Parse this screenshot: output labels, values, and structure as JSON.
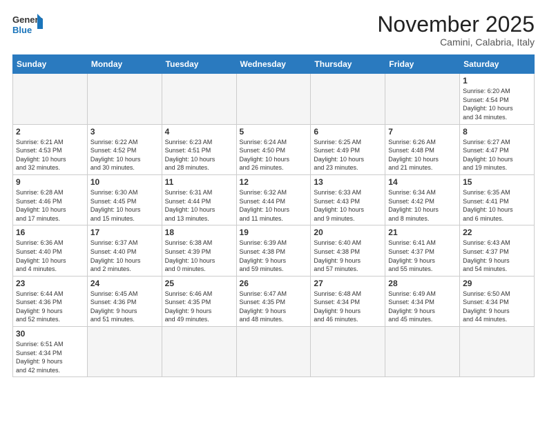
{
  "header": {
    "logo_general": "General",
    "logo_blue": "Blue",
    "month_title": "November 2025",
    "location": "Camini, Calabria, Italy"
  },
  "weekdays": [
    "Sunday",
    "Monday",
    "Tuesday",
    "Wednesday",
    "Thursday",
    "Friday",
    "Saturday"
  ],
  "weeks": [
    [
      {
        "day": "",
        "info": ""
      },
      {
        "day": "",
        "info": ""
      },
      {
        "day": "",
        "info": ""
      },
      {
        "day": "",
        "info": ""
      },
      {
        "day": "",
        "info": ""
      },
      {
        "day": "",
        "info": ""
      },
      {
        "day": "1",
        "info": "Sunrise: 6:20 AM\nSunset: 4:54 PM\nDaylight: 10 hours\nand 34 minutes."
      }
    ],
    [
      {
        "day": "2",
        "info": "Sunrise: 6:21 AM\nSunset: 4:53 PM\nDaylight: 10 hours\nand 32 minutes."
      },
      {
        "day": "3",
        "info": "Sunrise: 6:22 AM\nSunset: 4:52 PM\nDaylight: 10 hours\nand 30 minutes."
      },
      {
        "day": "4",
        "info": "Sunrise: 6:23 AM\nSunset: 4:51 PM\nDaylight: 10 hours\nand 28 minutes."
      },
      {
        "day": "5",
        "info": "Sunrise: 6:24 AM\nSunset: 4:50 PM\nDaylight: 10 hours\nand 26 minutes."
      },
      {
        "day": "6",
        "info": "Sunrise: 6:25 AM\nSunset: 4:49 PM\nDaylight: 10 hours\nand 23 minutes."
      },
      {
        "day": "7",
        "info": "Sunrise: 6:26 AM\nSunset: 4:48 PM\nDaylight: 10 hours\nand 21 minutes."
      },
      {
        "day": "8",
        "info": "Sunrise: 6:27 AM\nSunset: 4:47 PM\nDaylight: 10 hours\nand 19 minutes."
      }
    ],
    [
      {
        "day": "9",
        "info": "Sunrise: 6:28 AM\nSunset: 4:46 PM\nDaylight: 10 hours\nand 17 minutes."
      },
      {
        "day": "10",
        "info": "Sunrise: 6:30 AM\nSunset: 4:45 PM\nDaylight: 10 hours\nand 15 minutes."
      },
      {
        "day": "11",
        "info": "Sunrise: 6:31 AM\nSunset: 4:44 PM\nDaylight: 10 hours\nand 13 minutes."
      },
      {
        "day": "12",
        "info": "Sunrise: 6:32 AM\nSunset: 4:44 PM\nDaylight: 10 hours\nand 11 minutes."
      },
      {
        "day": "13",
        "info": "Sunrise: 6:33 AM\nSunset: 4:43 PM\nDaylight: 10 hours\nand 9 minutes."
      },
      {
        "day": "14",
        "info": "Sunrise: 6:34 AM\nSunset: 4:42 PM\nDaylight: 10 hours\nand 8 minutes."
      },
      {
        "day": "15",
        "info": "Sunrise: 6:35 AM\nSunset: 4:41 PM\nDaylight: 10 hours\nand 6 minutes."
      }
    ],
    [
      {
        "day": "16",
        "info": "Sunrise: 6:36 AM\nSunset: 4:40 PM\nDaylight: 10 hours\nand 4 minutes."
      },
      {
        "day": "17",
        "info": "Sunrise: 6:37 AM\nSunset: 4:40 PM\nDaylight: 10 hours\nand 2 minutes."
      },
      {
        "day": "18",
        "info": "Sunrise: 6:38 AM\nSunset: 4:39 PM\nDaylight: 10 hours\nand 0 minutes."
      },
      {
        "day": "19",
        "info": "Sunrise: 6:39 AM\nSunset: 4:38 PM\nDaylight: 9 hours\nand 59 minutes."
      },
      {
        "day": "20",
        "info": "Sunrise: 6:40 AM\nSunset: 4:38 PM\nDaylight: 9 hours\nand 57 minutes."
      },
      {
        "day": "21",
        "info": "Sunrise: 6:41 AM\nSunset: 4:37 PM\nDaylight: 9 hours\nand 55 minutes."
      },
      {
        "day": "22",
        "info": "Sunrise: 6:43 AM\nSunset: 4:37 PM\nDaylight: 9 hours\nand 54 minutes."
      }
    ],
    [
      {
        "day": "23",
        "info": "Sunrise: 6:44 AM\nSunset: 4:36 PM\nDaylight: 9 hours\nand 52 minutes."
      },
      {
        "day": "24",
        "info": "Sunrise: 6:45 AM\nSunset: 4:36 PM\nDaylight: 9 hours\nand 51 minutes."
      },
      {
        "day": "25",
        "info": "Sunrise: 6:46 AM\nSunset: 4:35 PM\nDaylight: 9 hours\nand 49 minutes."
      },
      {
        "day": "26",
        "info": "Sunrise: 6:47 AM\nSunset: 4:35 PM\nDaylight: 9 hours\nand 48 minutes."
      },
      {
        "day": "27",
        "info": "Sunrise: 6:48 AM\nSunset: 4:34 PM\nDaylight: 9 hours\nand 46 minutes."
      },
      {
        "day": "28",
        "info": "Sunrise: 6:49 AM\nSunset: 4:34 PM\nDaylight: 9 hours\nand 45 minutes."
      },
      {
        "day": "29",
        "info": "Sunrise: 6:50 AM\nSunset: 4:34 PM\nDaylight: 9 hours\nand 44 minutes."
      }
    ],
    [
      {
        "day": "30",
        "info": "Sunrise: 6:51 AM\nSunset: 4:34 PM\nDaylight: 9 hours\nand 42 minutes."
      },
      {
        "day": "",
        "info": ""
      },
      {
        "day": "",
        "info": ""
      },
      {
        "day": "",
        "info": ""
      },
      {
        "day": "",
        "info": ""
      },
      {
        "day": "",
        "info": ""
      },
      {
        "day": "",
        "info": ""
      }
    ]
  ]
}
